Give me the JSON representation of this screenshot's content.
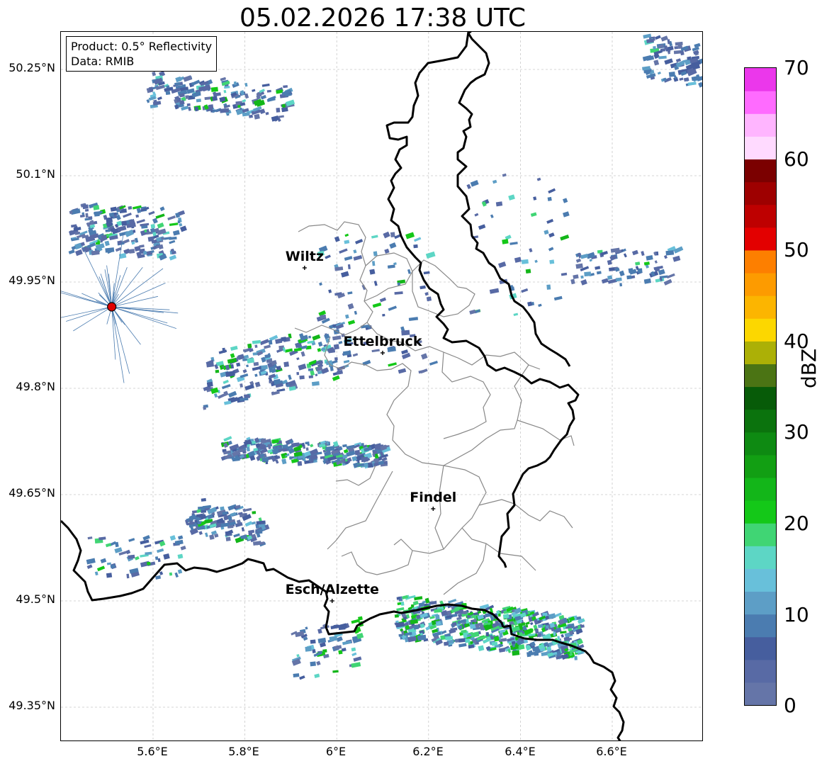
{
  "title": "05.02.2026 17:38 UTC",
  "info": {
    "product": "Product: 0.5° Reflectivity",
    "data": "Data: RMIB"
  },
  "y_ticks": [
    "50.25°N",
    "50.1°N",
    "49.95°N",
    "49.8°N",
    "49.65°N",
    "49.5°N",
    "49.35°N"
  ],
  "x_ticks": [
    "5.6°E",
    "5.8°E",
    "6°E",
    "6.2°E",
    "6.4°E",
    "6.6°E"
  ],
  "cities": [
    {
      "name": "Wiltz",
      "lon": 5.93,
      "lat": 49.97
    },
    {
      "name": "Ettelbruck",
      "lon": 6.1,
      "lat": 49.85
    },
    {
      "name": "Findel",
      "lon": 6.21,
      "lat": 49.63
    },
    {
      "name": "Esch/Alzette",
      "lon": 5.99,
      "lat": 49.5
    }
  ],
  "radar_site": {
    "lon": 5.51,
    "lat": 49.915,
    "color": "#e00000"
  },
  "colorbar": {
    "label": "dBZ",
    "ticks": [
      "0",
      "10",
      "20",
      "30",
      "40",
      "50",
      "60",
      "70"
    ],
    "colors": [
      "#6575a8",
      "#586aa5",
      "#465e9e",
      "#4b7cb0",
      "#5d9ec6",
      "#68c0da",
      "#5dd6c5",
      "#40d574",
      "#14c818",
      "#13b619",
      "#129f13",
      "#0e8a12",
      "#0b730d",
      "#075b08",
      "#4b7414",
      "#acb006",
      "#fcd700",
      "#fcb500",
      "#fd9b00",
      "#fd7f00",
      "#e30000",
      "#be0000",
      "#9e0000",
      "#7b0000",
      "#ffdaff",
      "#ffb5ff",
      "#ff6bff",
      "#eb37eb"
    ]
  }
}
